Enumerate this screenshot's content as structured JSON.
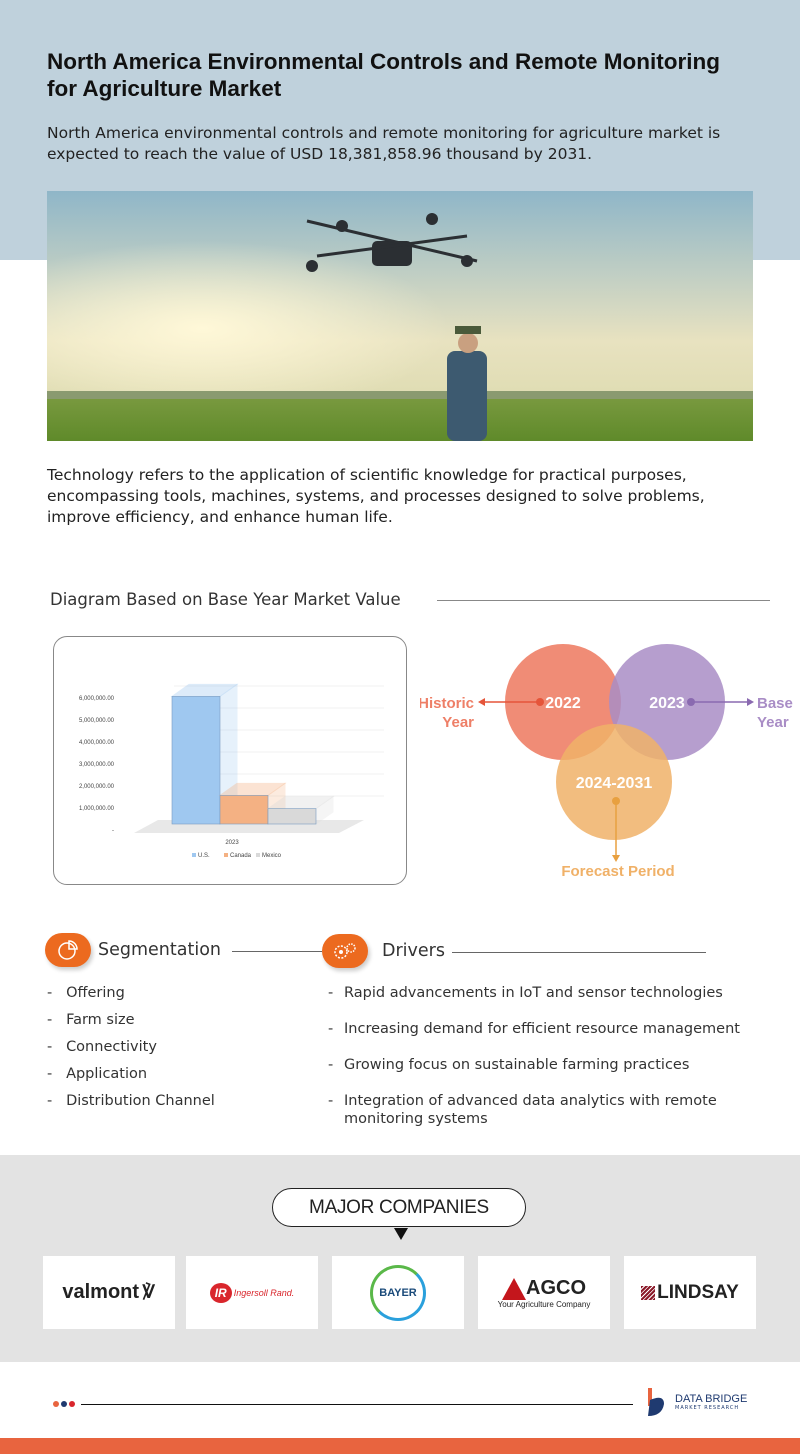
{
  "header": {
    "title": "North America Environmental Controls and Remote Monitoring for Agriculture Market",
    "subtitle": "North America environmental controls and remote monitoring for agriculture market is expected to reach the value of USD 18,381,858.96 thousand by 2031."
  },
  "description": "Technology refers to the application of scientific knowledge for practical purposes, encompassing tools, machines, systems, and processes designed to solve problems, improve efficiency, and enhance human life.",
  "diagram": {
    "title": "Diagram Based on Base Year Market Value"
  },
  "chart_data": {
    "type": "bar",
    "categories": [
      "2023"
    ],
    "series": [
      {
        "name": "U.S.",
        "values": [
          5800000
        ],
        "color": "#9fc8f0"
      },
      {
        "name": "Canada",
        "values": [
          1300000
        ],
        "color": "#f4b183"
      },
      {
        "name": "Mexico",
        "values": [
          700000
        ],
        "color": "#d9d9d9"
      }
    ],
    "ylim": [
      0,
      6000000
    ],
    "yticks": [
      "-",
      "1,000,000.00",
      "2,000,000.00",
      "3,000,000.00",
      "4,000,000.00",
      "5,000,000.00",
      "6,000,000.00"
    ],
    "legend": "bottom",
    "style": "3d"
  },
  "venn": {
    "historic": {
      "year": "2022",
      "label1": "Historic",
      "label2": "Year",
      "color": "#ee7f67"
    },
    "base": {
      "year": "2023",
      "label1": "Base",
      "label2": "Year",
      "color": "#a98dc6"
    },
    "forecast": {
      "year": "2024-2031",
      "label": "Forecast Period",
      "color": "#f0b168"
    }
  },
  "segmentation": {
    "title": "Segmentation",
    "items": [
      "Offering",
      "Farm size",
      "Connectivity",
      "Application",
      "Distribution Channel"
    ]
  },
  "drivers": {
    "title": "Drivers",
    "items": [
      "Rapid advancements in IoT and sensor technologies",
      "Increasing demand for efficient resource management",
      "Growing focus on sustainable farming practices",
      "Integration of advanced data analytics with remote monitoring systems"
    ]
  },
  "companies": {
    "title": "MAJOR COMPANIES",
    "logos": [
      "valmont",
      "Ingersoll Rand.",
      "BAYER",
      "AGCO",
      "Your Agriculture Company",
      "LINDSAY"
    ]
  },
  "footer": {
    "brand": "DATA BRIDGE",
    "tagline": "MARKET RESEARCH",
    "accent": "#e8643f"
  }
}
